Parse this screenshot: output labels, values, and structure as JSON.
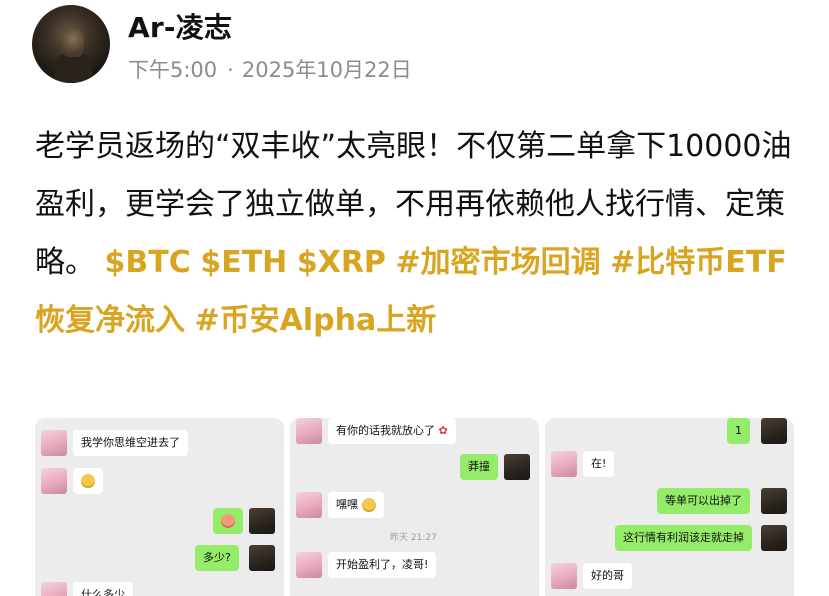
{
  "header": {
    "author": "Ar-凌志",
    "time": "下午5:00",
    "date": "2025年10月22日"
  },
  "post": {
    "body": "老学员返场的“双丰收”太亮眼！不仅第二单拿下10000油盈利，更学会了独立做单，不用再依赖他人找行情、定策略。",
    "tags": [
      "$BTC",
      "$ETH",
      "$XRP",
      "#加密市场回调",
      "#比特币ETF恢复净流入",
      "#币安Alpha上新"
    ]
  },
  "chat1": {
    "msg1": "我学你思维空进去了",
    "msg4": "多少?",
    "msg5": "什么多少"
  },
  "chat2": {
    "msg1": "有你的话我就放心了",
    "msg2": "莽撞",
    "msg3": "嘿嘿",
    "timestamp": "昨天 21:27",
    "msg4": "开始盈利了，凌哥!"
  },
  "chat3": {
    "msg1": "1",
    "msg2": "在!",
    "msg3": "等单可以出掉了",
    "msg4": "这行情有利润该走就走掉",
    "msg5": "好的哥"
  },
  "colors": {
    "tag": "#d9a520",
    "bubble_sent": "#95ec69",
    "bubble_received": "#ffffff",
    "meta": "#8c8c8c"
  }
}
